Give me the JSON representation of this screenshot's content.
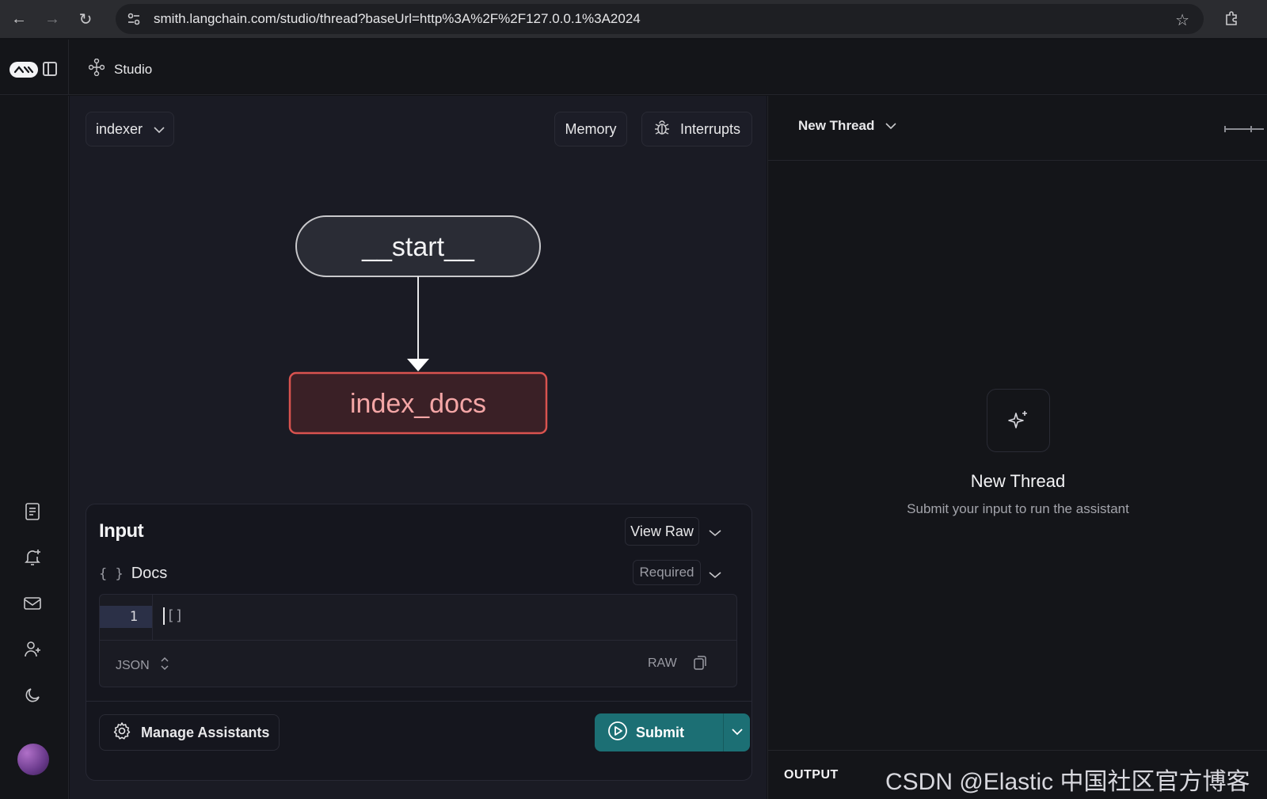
{
  "browser": {
    "url": "smith.langchain.com/studio/thread?baseUrl=http%3A%2F%2F127.0.0.1%3A2024"
  },
  "header": {
    "logo_text": "🦜🔗",
    "studio_label": "Studio"
  },
  "graph_panel": {
    "assistant_select": "indexer",
    "memory_label": "Memory",
    "interrupts_label": "Interrupts",
    "nodes": {
      "start": "__start__",
      "index_docs": "index_docs"
    }
  },
  "input_card": {
    "title": "Input",
    "view_raw_label": "View Raw",
    "field_braces": "{ }",
    "field_name": "Docs",
    "required_label": "Required",
    "line_number": "1",
    "code_value": "[]",
    "format_label": "JSON",
    "raw_label": "RAW",
    "manage_assistants_label": "Manage Assistants",
    "submit_label": "Submit"
  },
  "thread_panel": {
    "thread_select": "New Thread",
    "empty_title": "New Thread",
    "empty_subtitle": "Submit your input to run the assistant",
    "output_label": "OUTPUT",
    "watermark": "CSDN @Elastic 中国社区官方博客"
  },
  "colors": {
    "accent_submit": "#1c6f74",
    "node_error_border": "#d9534f",
    "node_error_fill": "#3a2026",
    "node_error_text": "#f4a6a6"
  }
}
